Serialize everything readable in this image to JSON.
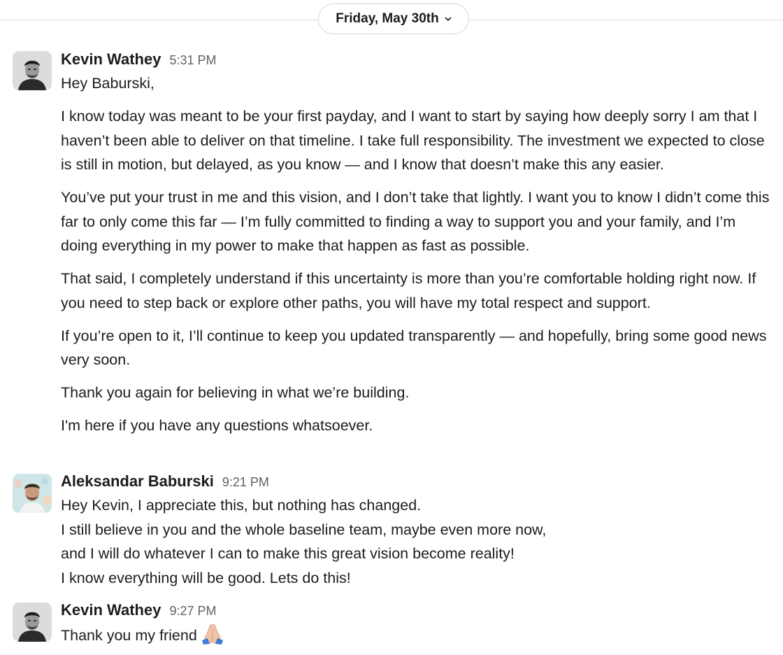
{
  "date_divider": {
    "label": "Friday, May 30th"
  },
  "messages": [
    {
      "author": "Kevin Wathey",
      "time": "5:31 PM",
      "paragraphs": [
        "Hey Baburski,",
        "I know today was meant to be your first payday, and I want to start by saying how deeply sorry I am that I haven’t been able to deliver on that timeline. I take full responsibility. The investment we expected to close is still in motion, but delayed, as you know — and I know that doesn’t make this any easier.",
        "You’ve put your trust in me and this vision, and I don’t take that lightly. I want you to know I didn’t come this far to only come this far — I’m fully committed to finding a way to support you and your family, and I’m doing everything in my power to make that happen as fast as possible.",
        "That said, I completely understand if this uncertainty is more than you’re comfortable holding right now. If you need to step back or explore other paths, you will have my total respect and support.",
        "If you’re open to it, I’ll continue to keep you updated transparently — and hopefully, bring some good news very soon.",
        "Thank you again for believing in what we’re building.",
        "I'm here if you have any questions whatsoever."
      ]
    },
    {
      "author": "Aleksandar Baburski",
      "time": "9:21 PM",
      "lines": [
        "Hey Kevin, I appreciate this, but nothing has changed.",
        "I still believe in you and the whole baseline team, maybe even more now,",
        "and I will do whatever I can to make this great vision become reality!",
        "I know everything will be good. Lets do this!"
      ]
    },
    {
      "author": "Kevin Wathey",
      "time": "9:27 PM",
      "text": "Thank you my friend",
      "emoji": "folded-hands"
    }
  ],
  "colors": {
    "text": "#1d1c1d",
    "timestamp": "#616061",
    "divider": "#dddddd"
  }
}
